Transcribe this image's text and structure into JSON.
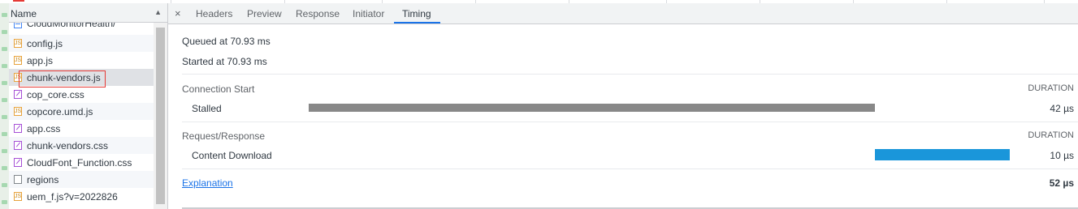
{
  "file_list": {
    "header": "Name",
    "sort_icon": "triangle-up-icon",
    "rows": [
      {
        "name": "CloudMonitorHealth/",
        "type": "document"
      },
      {
        "name": "config.js",
        "type": "script"
      },
      {
        "name": "app.js",
        "type": "script"
      },
      {
        "name": "chunk-vendors.js",
        "type": "script"
      },
      {
        "name": "cop_core.css",
        "type": "stylesheet"
      },
      {
        "name": "copcore.umd.js",
        "type": "script"
      },
      {
        "name": "app.css",
        "type": "stylesheet"
      },
      {
        "name": "chunk-vendors.css",
        "type": "stylesheet"
      },
      {
        "name": "CloudFont_Function.css",
        "type": "stylesheet"
      },
      {
        "name": "regions",
        "type": "other"
      },
      {
        "name": "uem_f.js?v=2022826",
        "type": "script"
      }
    ],
    "selected": "chunk-vendors.js"
  },
  "tabs": {
    "close": "×",
    "items": [
      "Headers",
      "Preview",
      "Response",
      "Initiator",
      "Timing"
    ],
    "active": "Timing"
  },
  "timing": {
    "queued": "Queued at 70.93 ms",
    "started": "Started at 70.93 ms",
    "connection_header": "Connection Start",
    "duration_label": "DURATION",
    "stalled": {
      "label": "Stalled",
      "value": "42 µs",
      "color": "#888888"
    },
    "request_header": "Request/Response",
    "download": {
      "label": "Content Download",
      "value": "10 µs",
      "color": "#1a96da"
    },
    "explanation": "Explanation",
    "total": "52 µs"
  },
  "colors": {
    "accent": "#1a73e8",
    "selection_box": "#e53935"
  }
}
